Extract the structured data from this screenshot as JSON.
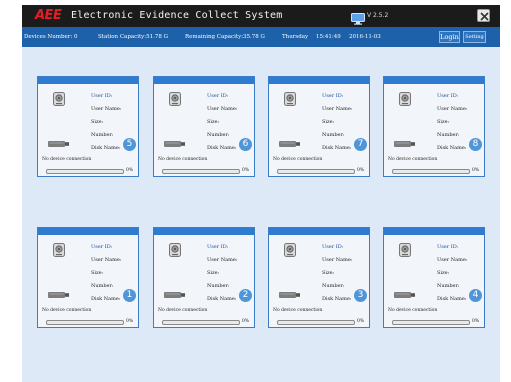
{
  "title_bar": {
    "logo": "AEE",
    "title": "Electronic Evidence Collect System",
    "version": "V 2.5.2",
    "close_icon": "close-icon",
    "monitor_icon": "monitor-icon"
  },
  "status_bar": {
    "devices_number": "Devices Number: 0",
    "station_capacity": "Station Capacity:51.78 G",
    "remaining_capacity": "Remaining Capacity:35.78 G",
    "day": "Thursday",
    "time": "15:41:49",
    "date": "2016-11-03",
    "login_label": "Login",
    "setting_label": "Setting"
  },
  "card_labels": {
    "user_id": "User ID:",
    "user_name": "User Name:",
    "size": "Size:",
    "number": "Number:",
    "disk_name": "Disk Name:",
    "connection": "No device connection"
  },
  "stations": [
    {
      "slot": "5",
      "percent": "0%",
      "progress": 0
    },
    {
      "slot": "6",
      "percent": "0%",
      "progress": 0
    },
    {
      "slot": "7",
      "percent": "0%",
      "progress": 0
    },
    {
      "slot": "8",
      "percent": "0%",
      "progress": 0
    },
    {
      "slot": "1",
      "percent": "0%",
      "progress": 0
    },
    {
      "slot": "2",
      "percent": "0%",
      "progress": 0
    },
    {
      "slot": "3",
      "percent": "0%",
      "progress": 0
    },
    {
      "slot": "4",
      "percent": "0%",
      "progress": 0
    }
  ],
  "colors": {
    "title_bar": "#1b1b1b",
    "status_bar": "#1c61a9",
    "card_header": "#2f7bcf",
    "slot_badge": "#4f95d8",
    "workspace": "#dde9f7"
  }
}
